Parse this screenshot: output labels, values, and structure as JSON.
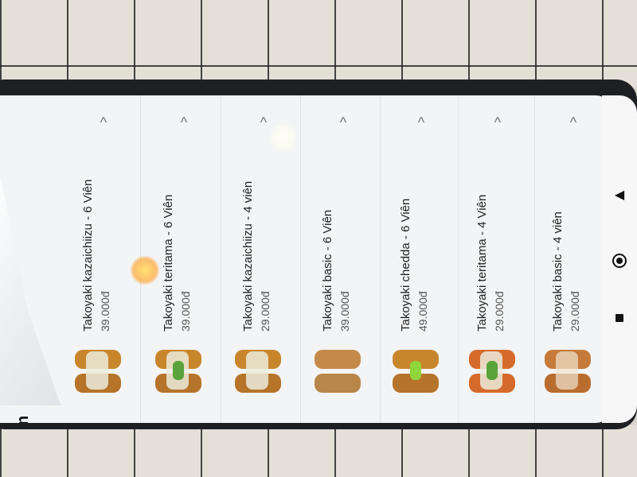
{
  "app": {
    "title": "Thực đơn"
  },
  "menu": {
    "items": [
      {
        "name": "Takoyaki kazaichiizu - 6 Viên",
        "price": "39.000đ",
        "icon": "chevron-up-icon"
      },
      {
        "name": "Takoyaki teritama - 6 Viên",
        "price": "39.000đ",
        "icon": "chevron-up-icon"
      },
      {
        "name": "Takoyaki kazaichiizu - 4 viên",
        "price": "29.000đ",
        "icon": "chevron-up-icon"
      },
      {
        "name": "Takoyaki basic - 6 Viên",
        "price": "39.000đ",
        "icon": "chevron-up-icon"
      },
      {
        "name": "Takoyaki chedda - 6 Viên",
        "price": "49.000đ",
        "icon": "chevron-up-icon"
      },
      {
        "name": "Takoyaki teritama - 4 Viên",
        "price": "29.000đ",
        "icon": "chevron-up-icon"
      },
      {
        "name": "Takoyaki basic - 4 viên",
        "price": "29.000đ",
        "icon": "chevron-up-icon"
      }
    ]
  },
  "navbar": {
    "back_icon": "back-triangle-icon",
    "home_icon": "home-circle-icon",
    "recent_icon": "recent-square-icon"
  },
  "colors": {
    "screen_bg": "#f3f4f5",
    "text": "#222222",
    "price_text": "#555555",
    "phone_frame": "#1d1f22"
  }
}
